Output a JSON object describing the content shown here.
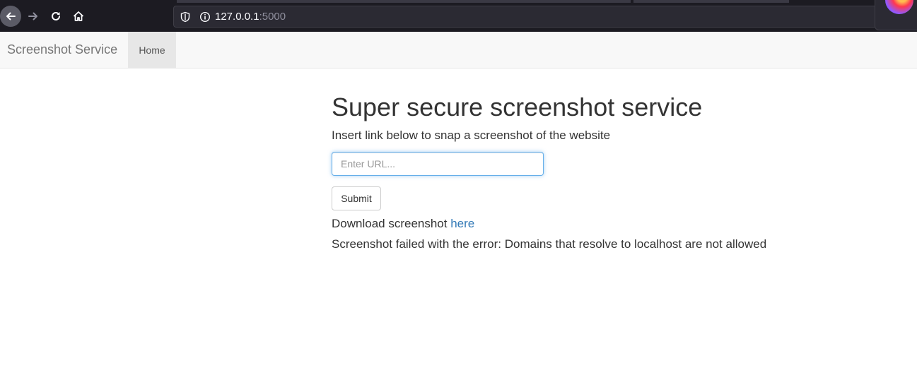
{
  "browser": {
    "url_host": "127.0.0.1",
    "url_port": ":5000",
    "icons": {
      "back": "back-arrow-icon",
      "forward": "forward-arrow-icon",
      "reload": "reload-icon",
      "home": "home-icon",
      "shield": "shield-icon",
      "info": "info-icon",
      "extension": "firefox-logo-icon"
    }
  },
  "navbar": {
    "brand": "Screenshot Service",
    "items": [
      {
        "label": "Home",
        "active": true
      }
    ]
  },
  "main": {
    "title": "Super secure screenshot service",
    "subtitle": "Insert link below to snap a screenshot of the website",
    "url_input": {
      "placeholder": "Enter URL...",
      "value": ""
    },
    "submit_label": "Submit",
    "download_prefix": "Download screenshot",
    "download_link_text": "here",
    "error_message": "Screenshot failed with the error: Domains that resolve to localhost are not allowed"
  },
  "colors": {
    "link": "#337ab7",
    "navbar_bg": "#f8f8f8",
    "browser_bg": "#1c1b22",
    "input_focus": "#66afe9"
  }
}
